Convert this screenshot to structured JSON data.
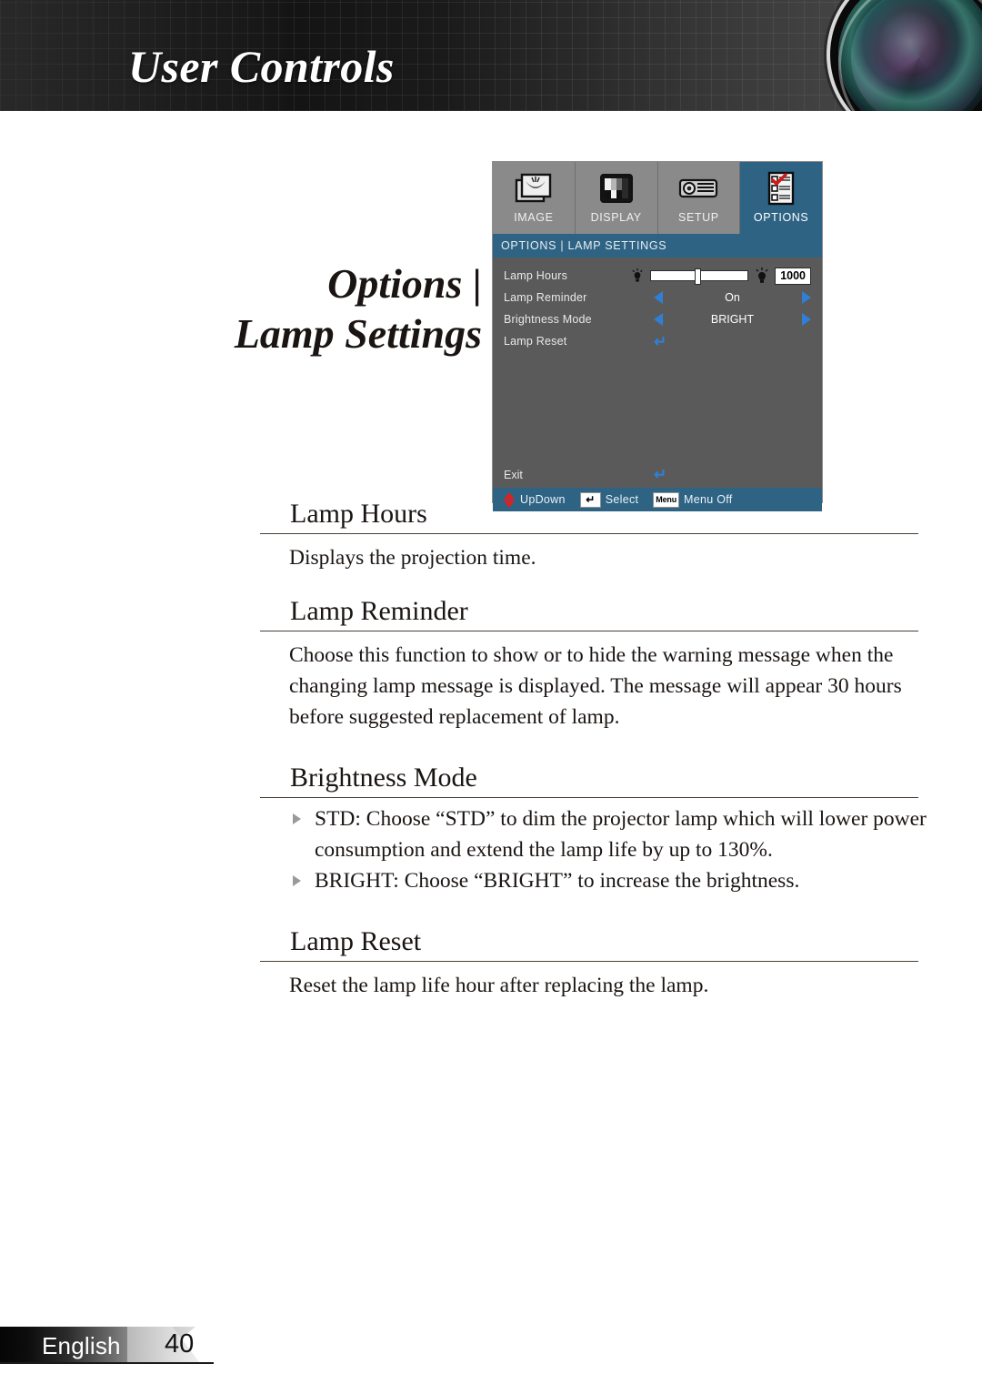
{
  "header": {
    "title": "User Controls",
    "lens_icon": "projector-lens-photo"
  },
  "doc_title": {
    "line1": "Options |",
    "line2": "Lamp Settings"
  },
  "osd": {
    "tabs": [
      {
        "label": "IMAGE",
        "icon": "image-stack-icon",
        "active": false
      },
      {
        "label": "DISPLAY",
        "icon": "test-pattern-icon",
        "active": false
      },
      {
        "label": "SETUP",
        "icon": "projector-side-icon",
        "active": false
      },
      {
        "label": "OPTIONS",
        "icon": "checklist-icon",
        "active": true
      }
    ],
    "titlebar": "OPTIONS | LAMP SETTINGS",
    "rows": [
      {
        "label": "Lamp Hours",
        "type": "slider",
        "value": "1000",
        "slider_pct": 45,
        "left_icon": "lamp-small-icon",
        "right_icon": "lamp-large-icon"
      },
      {
        "label": "Lamp Reminder",
        "type": "spinner",
        "value": "On"
      },
      {
        "label": "Brightness Mode",
        "type": "spinner",
        "value": "BRIGHT"
      },
      {
        "label": "Lamp Reset",
        "type": "enter",
        "value": "↵"
      }
    ],
    "exit": {
      "label": "Exit",
      "icon": "enter-arrow-icon"
    },
    "footer": [
      {
        "label": "UpDown",
        "icon": "up-down-arrow-icon"
      },
      {
        "label": "Select",
        "icon": "enter-key-icon",
        "key": "↵"
      },
      {
        "label": "Menu Off",
        "icon": "menu-key-icon",
        "key": "Menu"
      }
    ],
    "colors": {
      "accent": "#2e6384",
      "body": "#5a5a5a",
      "tab": "#8a8a8a",
      "arrow": "#2f7fd6",
      "updown": "#e02020"
    }
  },
  "sections": [
    {
      "heading": "Lamp Hours",
      "body": "Displays the projection time."
    },
    {
      "heading": "Lamp Reminder",
      "body": "Choose this function to show or to hide the warning message when the changing lamp message is displayed. The message will appear 30 hours before suggested replacement of lamp."
    },
    {
      "heading": "Brightness Mode",
      "bullets": [
        "STD: Choose “STD” to dim the projector lamp which will lower power consumption and extend the lamp life by up to 130%.",
        "BRIGHT: Choose “BRIGHT” to increase the brightness."
      ]
    },
    {
      "heading": "Lamp Reset",
      "body": "Reset the lamp life hour after replacing the lamp."
    }
  ],
  "page_footer": {
    "language": "English",
    "page_number": "40"
  }
}
